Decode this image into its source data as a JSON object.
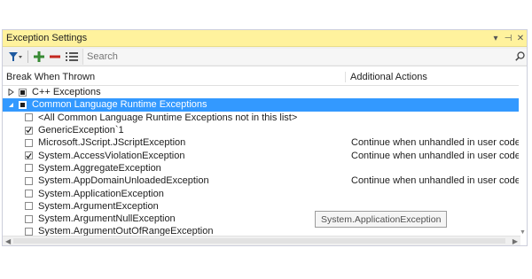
{
  "window": {
    "title": "Exception Settings",
    "dropdown_glyph": "▾",
    "pin_glyph": "⊣",
    "close_glyph": "✕"
  },
  "toolbar": {
    "filter_icon": "filter-icon",
    "add_icon": "add-icon",
    "remove_icon": "remove-icon",
    "conditions_icon": "edit-conditions-icon",
    "search_placeholder": "Search",
    "search_value": ""
  },
  "columns": {
    "col1": "Break When Thrown",
    "col2": "Additional Actions"
  },
  "rows": [
    {
      "label": "C++ Exceptions",
      "action": "",
      "level": 0,
      "check": "partial",
      "expander": "collapsed",
      "selected": false
    },
    {
      "label": "Common Language Runtime Exceptions",
      "action": "",
      "level": 0,
      "check": "partial",
      "expander": "expanded",
      "selected": true
    },
    {
      "label": "<All Common Language Runtime Exceptions not in this list>",
      "action": "",
      "level": 1,
      "check": "unchecked",
      "selected": false
    },
    {
      "label": "GenericException`1",
      "action": "",
      "level": 1,
      "check": "checked",
      "selected": false
    },
    {
      "label": "Microsoft.JScript.JScriptException",
      "action": "Continue when unhandled in user code",
      "level": 1,
      "check": "unchecked",
      "selected": false
    },
    {
      "label": "System.AccessViolationException",
      "action": "Continue when unhandled in user code",
      "level": 1,
      "check": "checked",
      "selected": false
    },
    {
      "label": "System.AggregateException",
      "action": "",
      "level": 1,
      "check": "unchecked",
      "selected": false
    },
    {
      "label": "System.AppDomainUnloadedException",
      "action": "Continue when unhandled in user code",
      "level": 1,
      "check": "unchecked",
      "selected": false
    },
    {
      "label": "System.ApplicationException",
      "action": "",
      "level": 1,
      "check": "unchecked",
      "selected": false
    },
    {
      "label": "System.ArgumentException",
      "action": "",
      "level": 1,
      "check": "unchecked",
      "selected": false
    },
    {
      "label": "System.ArgumentNullException",
      "action": "",
      "level": 1,
      "check": "unchecked",
      "selected": false
    },
    {
      "label": "System.ArgumentOutOfRangeException",
      "action": "",
      "level": 1,
      "check": "unchecked",
      "selected": false
    }
  ],
  "tooltip": "System.ApplicationException",
  "colors": {
    "title_bar": "#fff29d",
    "selection": "#3399ff",
    "add_green": "#388a34",
    "remove_red": "#c3281e",
    "filter_blue": "#1e5aa0"
  }
}
